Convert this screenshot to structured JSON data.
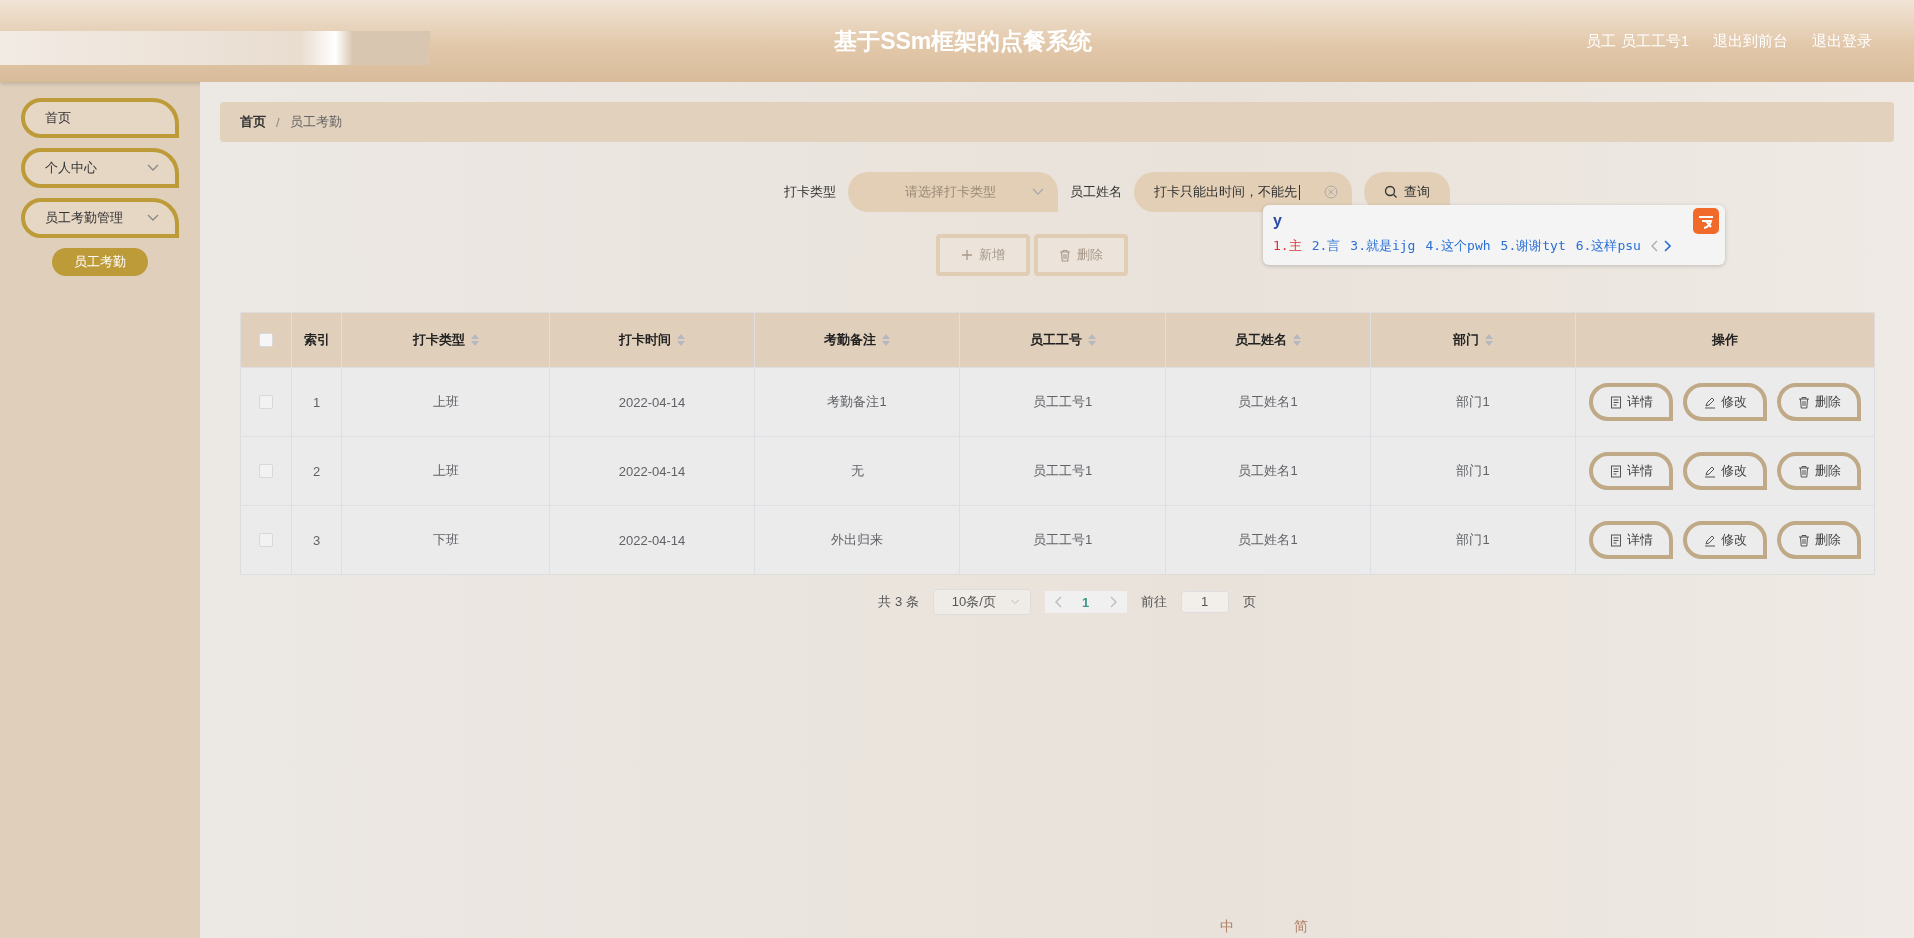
{
  "header": {
    "title": "基于SSm框架的点餐系统",
    "user": "员工 员工工号1",
    "links": [
      "退出到前台",
      "退出登录"
    ]
  },
  "sidebar": {
    "items": [
      {
        "label": "首页",
        "kind": "link"
      },
      {
        "label": "个人中心",
        "kind": "group"
      },
      {
        "label": "员工考勤管理",
        "kind": "group",
        "children": [
          {
            "label": "员工考勤",
            "selected": true
          }
        ]
      }
    ]
  },
  "breadcrumb": {
    "separator": "/",
    "items": [
      "首页",
      "员工考勤"
    ]
  },
  "search": {
    "type_label": "打卡类型",
    "type_placeholder": "请选择打卡类型",
    "name_label": "员工姓名",
    "name_value": "打卡只能出时间，不能先",
    "button": "查询"
  },
  "actions": [
    {
      "label": "新增",
      "kind": "add",
      "disabled": true
    },
    {
      "label": "删除",
      "kind": "delete",
      "disabled": true
    }
  ],
  "ime": {
    "input": "y",
    "candidates": [
      {
        "label": "1.主",
        "selected": true
      },
      {
        "label": "2.言",
        "selected": false
      },
      {
        "label": "3.就是ijg",
        "selected": false
      },
      {
        "label": "4.这个pwh",
        "selected": false
      },
      {
        "label": "5.谢谢tyt",
        "selected": false
      },
      {
        "label": "6.这样psu",
        "selected": false
      }
    ]
  },
  "table": {
    "all_checked": false,
    "columns": [
      {
        "label": "索引",
        "sortable": false
      },
      {
        "label": "打卡类型",
        "sortable": true
      },
      {
        "label": "打卡时间",
        "sortable": true
      },
      {
        "label": "考勤备注",
        "sortable": true
      },
      {
        "label": "员工工号",
        "sortable": true
      },
      {
        "label": "员工姓名",
        "sortable": true
      },
      {
        "label": "部门",
        "sortable": true
      },
      {
        "label": "操作",
        "sortable": false
      }
    ],
    "rows": [
      {
        "checked": false,
        "cells": [
          "1",
          "上班",
          "2022-04-14",
          "考勤备注1",
          "员工工号1",
          "员工姓名1",
          "部门1"
        ],
        "actions": [
          {
            "label": "详情",
            "kind": "detail"
          },
          {
            "label": "修改",
            "kind": "edit"
          },
          {
            "label": "删除",
            "kind": "delete"
          }
        ]
      },
      {
        "checked": false,
        "cells": [
          "2",
          "上班",
          "2022-04-14",
          "无",
          "员工工号1",
          "员工姓名1",
          "部门1"
        ],
        "actions": [
          {
            "label": "详情",
            "kind": "detail"
          },
          {
            "label": "修改",
            "kind": "edit"
          },
          {
            "label": "删除",
            "kind": "delete"
          }
        ]
      },
      {
        "checked": false,
        "cells": [
          "3",
          "下班",
          "2022-04-14",
          "外出归来",
          "员工工号1",
          "员工姓名1",
          "部门1"
        ],
        "actions": [
          {
            "label": "详情",
            "kind": "detail"
          },
          {
            "label": "修改",
            "kind": "edit"
          },
          {
            "label": "删除",
            "kind": "delete"
          }
        ]
      }
    ]
  },
  "pagination": {
    "total": "共 3 条",
    "page_size": "10条/页",
    "page": "1",
    "goto_label": "前往",
    "goto_value": "1",
    "goto_suffix": "页"
  },
  "ime_toolbar": {
    "labels": [
      "中",
      "简"
    ]
  }
}
